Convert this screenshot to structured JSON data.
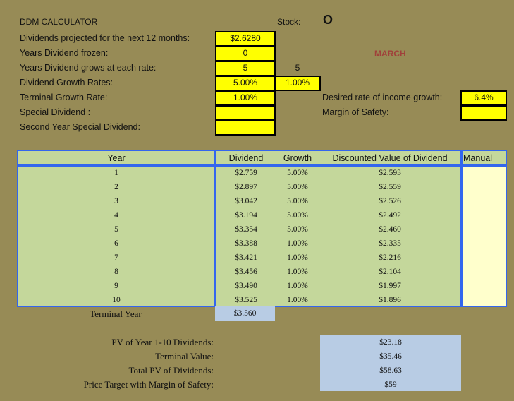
{
  "title": "DDM CALCULATOR",
  "stock_label": "Stock:",
  "stock_value": "O",
  "month": "MARCH",
  "inputs": [
    {
      "label": "Dividends projected for the next 12 months:",
      "value": "$2.6280"
    },
    {
      "label": "Years Dividend frozen:",
      "value": "0"
    },
    {
      "label": "Years Dividend grows at each rate:",
      "value": "5",
      "value2": "5"
    },
    {
      "label": "Dividend Growth Rates:",
      "value": "5.00%",
      "value2": "1.00%"
    },
    {
      "label": "Terminal Growth Rate:",
      "value": "1.00%"
    },
    {
      "label": "Special Dividend :",
      "value": ""
    },
    {
      "label": "Second Year Special Dividend:",
      "value": ""
    }
  ],
  "right_inputs": [
    {
      "label": "Desired rate of income growth:",
      "value": "6.4%"
    },
    {
      "label": "Margin of Safety:",
      "value": ""
    }
  ],
  "table": {
    "headers": [
      "Year",
      "Dividend",
      "Growth",
      "Discounted Value of Dividend",
      "Manual"
    ],
    "rows": [
      [
        "1",
        "$2.759",
        "5.00%",
        "$2.593"
      ],
      [
        "2",
        "$2.897",
        "5.00%",
        "$2.559"
      ],
      [
        "3",
        "$3.042",
        "5.00%",
        "$2.526"
      ],
      [
        "4",
        "$3.194",
        "5.00%",
        "$2.492"
      ],
      [
        "5",
        "$3.354",
        "5.00%",
        "$2.460"
      ],
      [
        "6",
        "$3.388",
        "1.00%",
        "$2.335"
      ],
      [
        "7",
        "$3.421",
        "1.00%",
        "$2.216"
      ],
      [
        "8",
        "$3.456",
        "1.00%",
        "$2.104"
      ],
      [
        "9",
        "$3.490",
        "1.00%",
        "$1.997"
      ],
      [
        "10",
        "$3.525",
        "1.00%",
        "$1.896"
      ]
    ],
    "terminal_label": "Terminal Year",
    "terminal_value": "$3.560"
  },
  "summary": [
    {
      "label": "PV of Year 1-10 Dividends:",
      "value": "$23.18"
    },
    {
      "label": "Terminal Value:",
      "value": "$35.46"
    },
    {
      "label": "Total PV of Dividends:",
      "value": "$58.63"
    },
    {
      "label": "Price Target with Margin of Safety:",
      "value": "$59"
    }
  ]
}
